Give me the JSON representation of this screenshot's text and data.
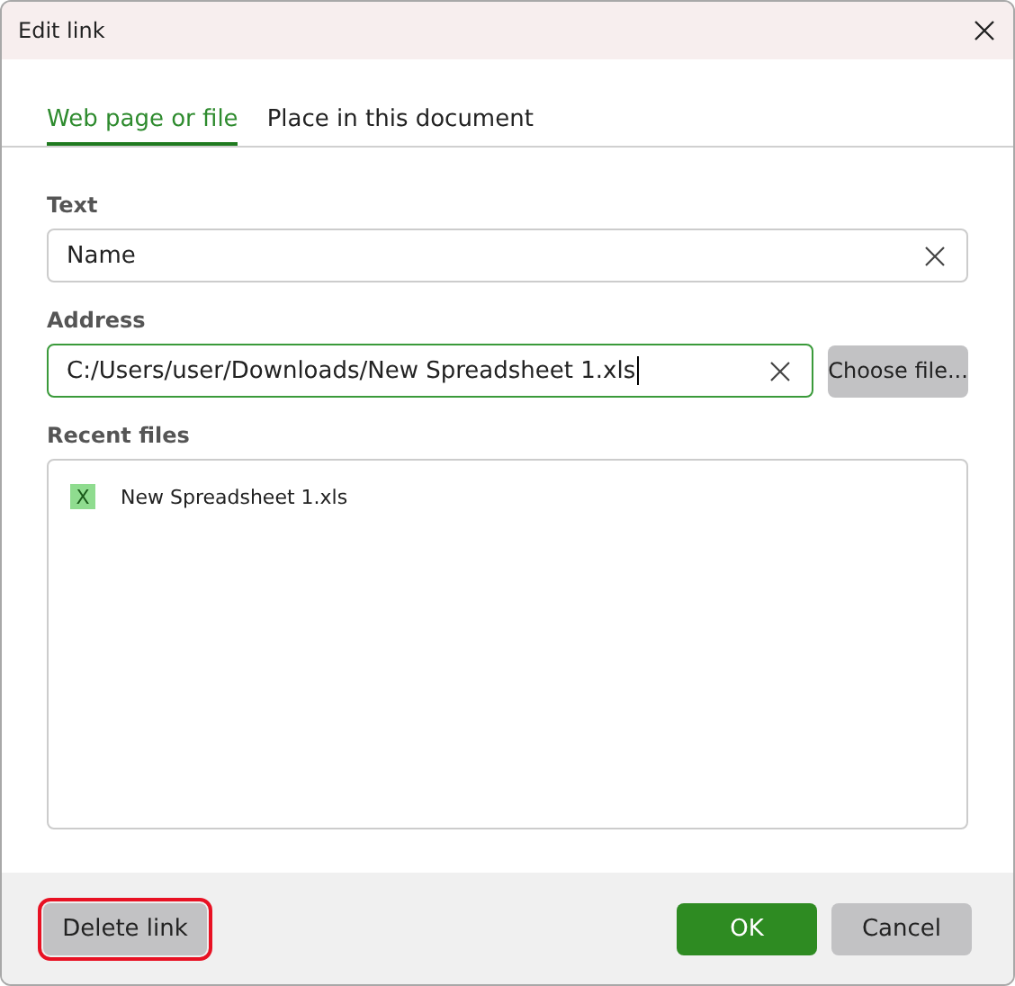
{
  "window": {
    "title": "Edit link"
  },
  "tabs": [
    {
      "label": "Web page or file",
      "selected": true
    },
    {
      "label": "Place in this document",
      "selected": false
    }
  ],
  "text_field": {
    "label": "Text",
    "value": "Name",
    "focused": false
  },
  "address_field": {
    "label": "Address",
    "value": "C:/Users/user/Downloads/New Spreadsheet 1.xls",
    "focused": true
  },
  "choose_file_button": "Choose file...",
  "recent_files": {
    "label": "Recent files",
    "items": [
      {
        "icon_text": "X",
        "name": "New Spreadsheet 1.xls",
        "selected": false
      }
    ]
  },
  "footer": {
    "delete_button": {
      "label": "Delete link",
      "highlighted": true
    },
    "ok_button": "OK",
    "cancel_button": "Cancel"
  }
}
